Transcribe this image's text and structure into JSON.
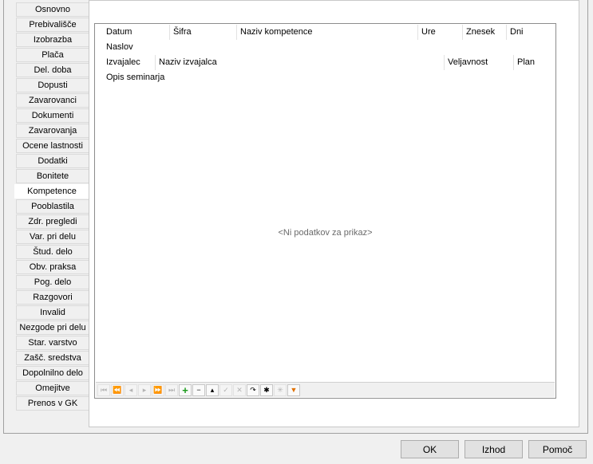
{
  "tabs": [
    {
      "label": "Osnovno"
    },
    {
      "label": "Prebivališče"
    },
    {
      "label": "Izobrazba"
    },
    {
      "label": "Plača"
    },
    {
      "label": "Del. doba"
    },
    {
      "label": "Dopusti"
    },
    {
      "label": "Zavarovanci"
    },
    {
      "label": "Dokumenti"
    },
    {
      "label": "Zavarovanja"
    },
    {
      "label": "Ocene lastnosti"
    },
    {
      "label": "Dodatki"
    },
    {
      "label": "Bonitete"
    },
    {
      "label": "Kompetence",
      "active": true
    },
    {
      "label": "Pooblastila"
    },
    {
      "label": "Zdr. pregledi"
    },
    {
      "label": "Var. pri delu"
    },
    {
      "label": "Štud. delo"
    },
    {
      "label": "Obv. praksa"
    },
    {
      "label": "Pog. delo"
    },
    {
      "label": "Razgovori"
    },
    {
      "label": "Invalid"
    },
    {
      "label": "Nezgode pri delu"
    },
    {
      "label": "Star. varstvo"
    },
    {
      "label": "Zašč. sredstva"
    },
    {
      "label": "Dopolnilno delo"
    },
    {
      "label": "Omejitve"
    },
    {
      "label": "Prenos v GK"
    }
  ],
  "grid": {
    "header_rows": [
      [
        "Datum",
        "Šifra",
        "Naziv kompetence",
        "Ure",
        "Znesek",
        "Dni"
      ],
      [
        "Naslov"
      ],
      [
        "Izvajalec",
        "Naziv izvajalca",
        "Veljavnost",
        "Plan"
      ],
      [
        "Opis seminarja"
      ]
    ],
    "empty_text": "<Ni podatkov za prikaz>"
  },
  "navigator": {
    "buttons": [
      {
        "name": "first-page",
        "glyph": "⏮"
      },
      {
        "name": "prev-page",
        "glyph": "⏪"
      },
      {
        "name": "prev-record",
        "glyph": "◂"
      },
      {
        "name": "next-record",
        "glyph": "▸"
      },
      {
        "name": "next-page",
        "glyph": "⏩"
      },
      {
        "name": "last-page",
        "glyph": "⏭"
      },
      {
        "name": "add",
        "glyph": "+"
      },
      {
        "name": "delete",
        "glyph": "−"
      },
      {
        "name": "edit",
        "glyph": "▴"
      },
      {
        "name": "post",
        "glyph": "✓"
      },
      {
        "name": "cancel",
        "glyph": "✕"
      },
      {
        "name": "refresh",
        "glyph": "↷"
      },
      {
        "name": "bookmark",
        "glyph": "✱"
      },
      {
        "name": "goto-bookmark",
        "glyph": "✳"
      },
      {
        "name": "filter",
        "glyph": "▼"
      }
    ]
  },
  "buttons": {
    "ok": "OK",
    "exit": "Izhod",
    "help": "Pomoč"
  }
}
